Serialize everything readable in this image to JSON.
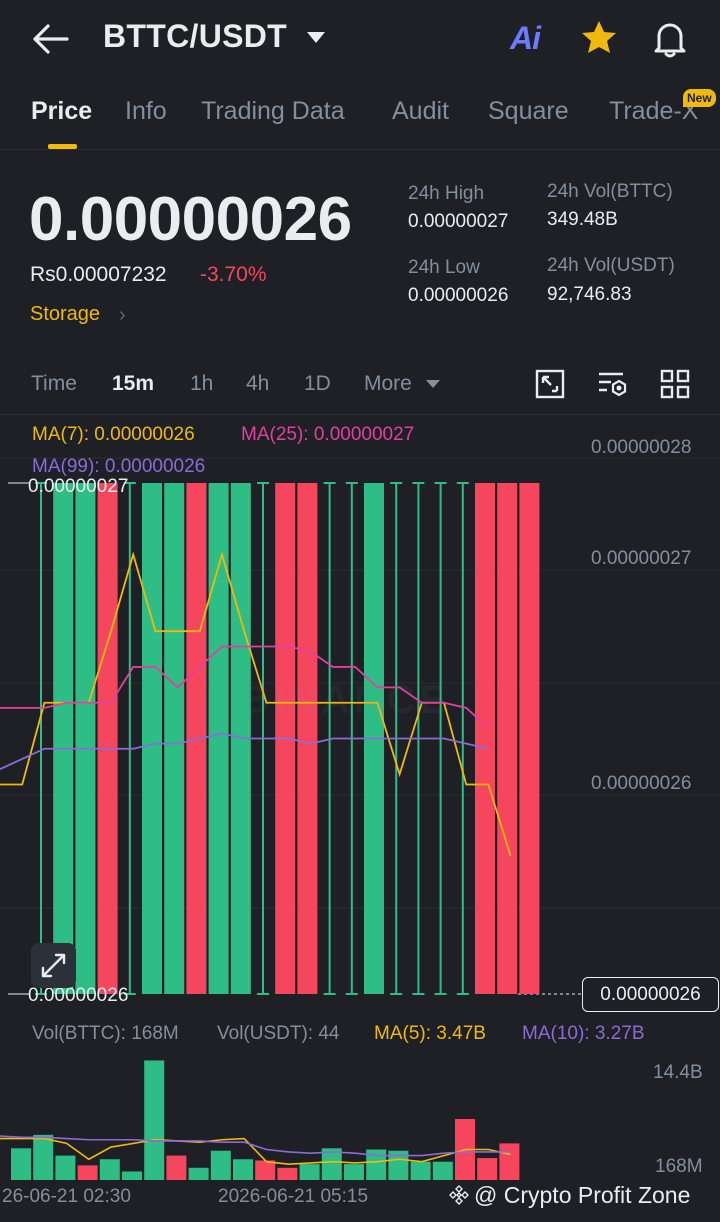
{
  "header": {
    "pair": "BTTC/USDT",
    "ai_label": "Ai",
    "icons": [
      "back-arrow-icon",
      "chevron-down-icon",
      "ai-icon",
      "star-icon",
      "bell-icon"
    ]
  },
  "tabs": [
    {
      "label": "Price",
      "active": true
    },
    {
      "label": "Info"
    },
    {
      "label": "Trading Data"
    },
    {
      "label": "Audit"
    },
    {
      "label": "Square"
    },
    {
      "label": "Trade-X",
      "badge": "New"
    }
  ],
  "ticker": {
    "price": "0.00000026",
    "fiat_price": "Rs0.00007232",
    "change": "-3.70%",
    "storage_label": "Storage",
    "stats": {
      "high_label": "24h High",
      "high_value": "0.00000027",
      "low_label": "24h Low",
      "low_value": "0.00000026",
      "vol_base_label": "24h Vol(BTTC)",
      "vol_base_value": "349.48B",
      "vol_quote_label": "24h Vol(USDT)",
      "vol_quote_value": "92,746.83"
    }
  },
  "timeframes": {
    "items": [
      "Time",
      "15m",
      "1h",
      "4h",
      "1D",
      "More"
    ],
    "active": "15m",
    "tool_icons": [
      "fullscreen-icon",
      "indicator-settings-icon",
      "layout-grid-icon"
    ]
  },
  "chart": {
    "ma7": "MA(7): 0.00000026",
    "ma25": "MA(25): 0.00000027",
    "ma99": "MA(99): 0.00000026",
    "high_marker": "0.00000027",
    "low_marker": "0.00000026",
    "last_price": "0.00000026",
    "y_axis": [
      "0.00000028",
      "0.00000027",
      "0.00000026"
    ],
    "vol_base": "Vol(BTTC): 168M",
    "vol_quote": "Vol(USDT): 44",
    "vol_ma5": "MA(5): 3.47B",
    "vol_ma10": "MA(10): 3.27B",
    "vol_axis_top": "14.4B",
    "vol_axis_bottom": "168M",
    "dates": [
      "26-06-21 02:30",
      "2026-06-21 05:15"
    ],
    "credit": "@ Crypto Profit Zone",
    "colors": {
      "up": "#2ebd85",
      "down": "#f6465d",
      "ma7": "#f0b90b",
      "ma25": "#e040a0",
      "ma99": "#8c6bd6"
    }
  },
  "chart_data": {
    "type": "candlestick",
    "series_note": "15m candles, BTTC/USDT",
    "candles": [
      {
        "dir": "up",
        "open": 2.6e-07,
        "close": 2.6e-07
      },
      {
        "dir": "up",
        "open": 2.6e-07,
        "close": 2.7e-07
      },
      {
        "dir": "up",
        "open": 2.6e-07,
        "close": 2.7e-07
      },
      {
        "dir": "down",
        "open": 2.7e-07,
        "close": 2.6e-07
      },
      {
        "dir": "up",
        "open": 2.6e-07,
        "close": 2.6e-07
      },
      {
        "dir": "up",
        "open": 2.6e-07,
        "close": 2.7e-07
      },
      {
        "dir": "up",
        "open": 2.6e-07,
        "close": 2.7e-07
      },
      {
        "dir": "down",
        "open": 2.7e-07,
        "close": 2.6e-07
      },
      {
        "dir": "up",
        "open": 2.6e-07,
        "close": 2.7e-07
      },
      {
        "dir": "up",
        "open": 2.6e-07,
        "close": 2.7e-07
      },
      {
        "dir": "up",
        "open": 2.6e-07,
        "close": 2.6e-07
      },
      {
        "dir": "down",
        "open": 2.7e-07,
        "close": 2.6e-07
      },
      {
        "dir": "down",
        "open": 2.7e-07,
        "close": 2.6e-07
      },
      {
        "dir": "up",
        "open": 2.6e-07,
        "close": 2.6e-07
      },
      {
        "dir": "up",
        "open": 2.6e-07,
        "close": 2.6e-07
      },
      {
        "dir": "up",
        "open": 2.6e-07,
        "close": 2.7e-07
      },
      {
        "dir": "up",
        "open": 2.6e-07,
        "close": 2.6e-07
      },
      {
        "dir": "up",
        "open": 2.6e-07,
        "close": 2.6e-07
      },
      {
        "dir": "up",
        "open": 2.6e-07,
        "close": 2.6e-07
      },
      {
        "dir": "up",
        "open": 2.6e-07,
        "close": 2.6e-07
      },
      {
        "dir": "down",
        "open": 2.7e-07,
        "close": 2.6e-07
      },
      {
        "dir": "down",
        "open": 2.7e-07,
        "close": 2.6e-07
      },
      {
        "dir": "down",
        "open": 2.7e-07,
        "close": 2.6e-07
      }
    ],
    "candle_fill": [
      0,
      1,
      1,
      1,
      0,
      1,
      1,
      1,
      1,
      1,
      0,
      1,
      1,
      0,
      0,
      1,
      0,
      0,
      0,
      0,
      1,
      1,
      1
    ],
    "ma7_norm": [
      0.59,
      0.59,
      0.43,
      0.43,
      0.43,
      0.29,
      0.14,
      0.29,
      0.29,
      0.29,
      0.14,
      0.29,
      0.43,
      0.43,
      0.43,
      0.43,
      0.43,
      0.43,
      0.57,
      0.43,
      0.43,
      0.59,
      0.59,
      0.73
    ],
    "ma25_norm": [
      0.44,
      0.44,
      0.44,
      0.43,
      0.43,
      0.43,
      0.36,
      0.36,
      0.4,
      0.36,
      0.32,
      0.32,
      0.32,
      0.32,
      0.33,
      0.36,
      0.36,
      0.4,
      0.4,
      0.43,
      0.43,
      0.44,
      0.48
    ],
    "ma99_norm": [
      0.56,
      0.54,
      0.52,
      0.52,
      0.52,
      0.52,
      0.52,
      0.51,
      0.51,
      0.5,
      0.49,
      0.5,
      0.5,
      0.5,
      0.51,
      0.5,
      0.5,
      0.5,
      0.5,
      0.5,
      0.5,
      0.51,
      0.52
    ],
    "volume": [
      0.26,
      0.37,
      0.2,
      0.12,
      0.17,
      0.07,
      0.98,
      0.2,
      0.1,
      0.24,
      0.17,
      0.16,
      0.1,
      0.13,
      0.26,
      0.13,
      0.25,
      0.24,
      0.15,
      0.15,
      0.5,
      0.18,
      0.3
    ],
    "vol_ma5_norm": [
      0.34,
      0.34,
      0.34,
      0.3,
      0.17,
      0.27,
      0.3,
      0.33,
      0.32,
      0.31,
      0.33,
      0.34,
      0.15,
      0.13,
      0.14,
      0.15,
      0.14,
      0.15,
      0.17,
      0.15,
      0.2,
      0.25,
      0.25,
      0.21
    ],
    "vol_ma10_norm": [
      0.36,
      0.35,
      0.35,
      0.34,
      0.33,
      0.33,
      0.33,
      0.32,
      0.32,
      0.32,
      0.31,
      0.31,
      0.25,
      0.23,
      0.22,
      0.23,
      0.22,
      0.2,
      0.2,
      0.2,
      0.22,
      0.23,
      0.23,
      0.23
    ]
  }
}
